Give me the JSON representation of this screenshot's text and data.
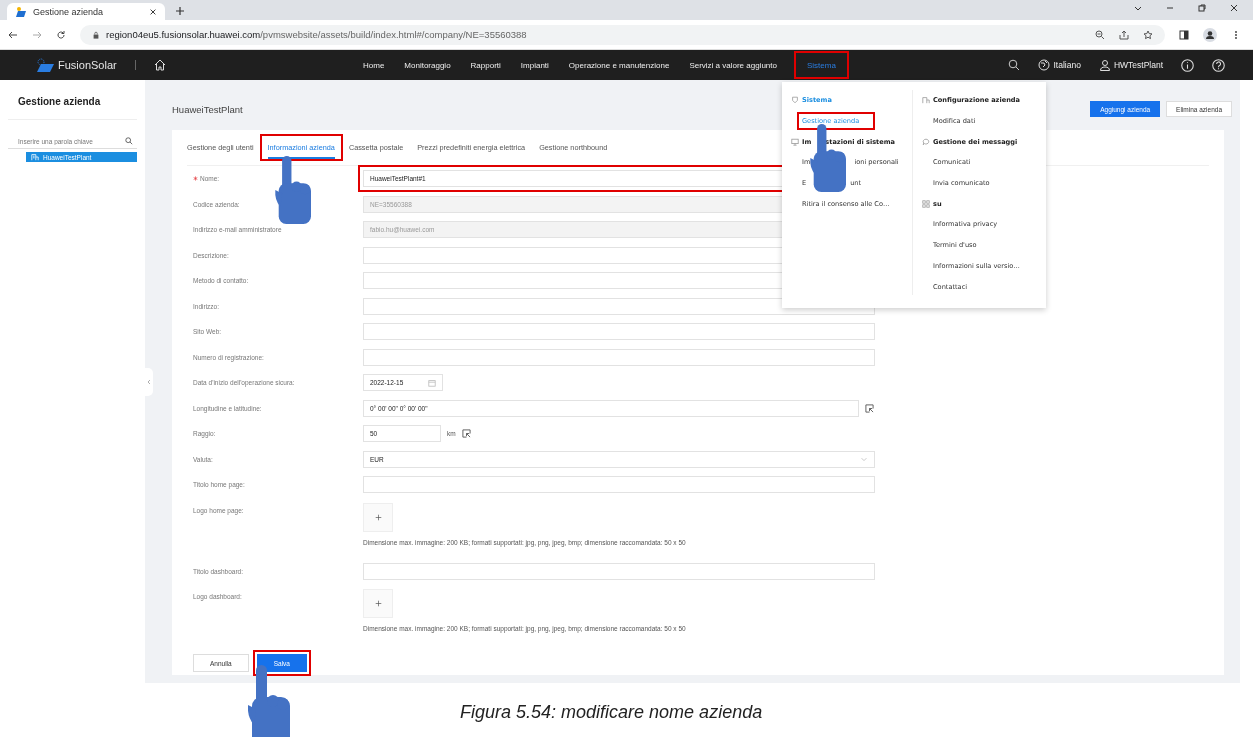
{
  "browser": {
    "tab": {
      "title": "Gestione azienda"
    },
    "url": {
      "host": "region04eu5.fusionsolar.huawei.com",
      "path": "/pvmswebsite/assets/build/index.html#/company/NE=35560388"
    }
  },
  "app_header": {
    "logo": "FusionSolar",
    "nav": [
      {
        "label": "Home",
        "selected": false,
        "highlighted": false
      },
      {
        "label": "Monitoraggio",
        "selected": false,
        "highlighted": false
      },
      {
        "label": "Rapporti",
        "selected": false,
        "highlighted": false
      },
      {
        "label": "Impianti",
        "selected": false,
        "highlighted": false
      },
      {
        "label": "Operazione e manutenzione",
        "selected": false,
        "highlighted": false
      },
      {
        "label": "Servizi a valore aggiunto",
        "selected": false,
        "highlighted": false
      },
      {
        "label": "Sistema",
        "selected": true,
        "highlighted": true
      }
    ],
    "language": "Italiano",
    "user": "HWTestPlant"
  },
  "sidebar": {
    "title": "Gestione azienda",
    "search": {
      "placeholder": "Inserire una parola chiave"
    },
    "tree": [
      {
        "label": "HuaweiTestPlant",
        "selected": true
      }
    ]
  },
  "page": {
    "title": "HuaweiTestPlant",
    "actions": [
      {
        "label": "Aggiungi azienda",
        "kind": "primary"
      },
      {
        "label": "Elimina azienda",
        "kind": "default"
      }
    ],
    "tabs": [
      {
        "label": "Gestione degli utenti",
        "selected": false,
        "highlighted": false
      },
      {
        "label": "Informazioni azienda",
        "selected": true,
        "highlighted": true
      },
      {
        "label": "Cassetta postale",
        "selected": false,
        "highlighted": false
      },
      {
        "label": "Prezzi predefiniti energia elettrica",
        "selected": false,
        "highlighted": false
      },
      {
        "label": "Gestione northbound",
        "selected": false,
        "highlighted": false
      }
    ],
    "form": [
      {
        "label": "Nome:",
        "kind": "text",
        "value": "HuaweiTestPlant#1",
        "required": true,
        "disabled": false,
        "highlighted": true
      },
      {
        "label": "Codice azienda:",
        "kind": "text",
        "value": "NE=35560388",
        "required": false,
        "disabled": true,
        "highlighted": false
      },
      {
        "label": "Indirizzo e-mail amministratore",
        "kind": "text",
        "value": "fabio.hu@huawei.com",
        "required": false,
        "disabled": true,
        "highlighted": false
      },
      {
        "label": "Descrizione:",
        "kind": "text",
        "required": false,
        "disabled": false,
        "highlighted": false
      },
      {
        "label": "Metodo di contatto:",
        "kind": "text",
        "required": false,
        "disabled": false,
        "highlighted": false
      },
      {
        "label": "Indirizzo:",
        "kind": "text",
        "required": false,
        "disabled": false,
        "highlighted": false
      },
      {
        "label": "Sito Web:",
        "kind": "text",
        "required": false,
        "disabled": false,
        "highlighted": false
      },
      {
        "label": "Numero di registrazione:",
        "kind": "text",
        "required": false,
        "disabled": false,
        "highlighted": false
      },
      {
        "label": "Data d'inizio dell'operazione sicura:",
        "kind": "date",
        "value": "2022-12-15",
        "required": false,
        "highlighted": false
      },
      {
        "label": "Longitudine e latitudine:",
        "kind": "coords",
        "value": "0° 00' 00\" 0° 00' 00\"",
        "required": false,
        "highlighted": false
      },
      {
        "label": "Raggio:",
        "kind": "number_unit",
        "value": "50",
        "unit": "km",
        "required": false,
        "highlighted": false
      },
      {
        "label": "Valuta:",
        "kind": "select",
        "value": "EUR",
        "required": false,
        "highlighted": false
      },
      {
        "label": "Titolo home page:",
        "kind": "text",
        "required": false,
        "disabled": false,
        "highlighted": false
      },
      {
        "label": "Logo home page:",
        "kind": "upload",
        "hint": "Dimensione max. immagine: 200 KB; formati supportati: jpg, png, jpeg, bmp; dimensione raccomandata: 50 x 50",
        "required": false,
        "highlighted": false
      },
      {
        "label": "Titolo dashboard:",
        "kind": "text",
        "required": false,
        "disabled": false,
        "highlighted": false
      },
      {
        "label": "Logo dashboard:",
        "kind": "upload",
        "hint": "Dimensione max. immagine: 200 KB; formati supportati: jpg, png, jpeg, bmp; dimensione raccomandata: 50 x 50",
        "required": false,
        "highlighted": false
      }
    ],
    "buttons": [
      {
        "label": "Annulla",
        "kind": "default",
        "highlighted": false
      },
      {
        "label": "Salva",
        "kind": "primary",
        "highlighted": true
      }
    ]
  },
  "system_menu": {
    "columns": [
      [
        {
          "kind": "header",
          "parts": [
            "Sistema"
          ],
          "selected": true,
          "highlighted": false
        },
        {
          "kind": "item",
          "parts": [
            "Gestione azienda"
          ],
          "selected": true,
          "highlighted": true
        },
        {
          "kind": "header",
          "parts": [
            "Im",
            "stazioni di sistema"
          ],
          "selected": false,
          "highlighted": false
        },
        {
          "kind": "item",
          "parts": [
            "Im",
            "ioni personali"
          ],
          "selected": false,
          "highlighted": false
        },
        {
          "kind": "item",
          "parts": [
            "E",
            "unt"
          ],
          "selected": false,
          "highlighted": false
        },
        {
          "kind": "item",
          "parts": [
            "Ritira il consenso alle Co…"
          ],
          "selected": false,
          "highlighted": false
        }
      ],
      [
        {
          "kind": "header",
          "parts": [
            "Configurazione azienda"
          ],
          "selected": false,
          "highlighted": false
        },
        {
          "kind": "item",
          "parts": [
            "Modifica dati"
          ],
          "selected": false,
          "highlighted": false
        },
        {
          "kind": "header",
          "parts": [
            "Gestione dei messaggi"
          ],
          "selected": false,
          "highlighted": false
        },
        {
          "kind": "item",
          "parts": [
            "Comunicati"
          ],
          "selected": false,
          "highlighted": false
        },
        {
          "kind": "item",
          "parts": [
            "Invia comunicato"
          ],
          "selected": false,
          "highlighted": false
        },
        {
          "kind": "header",
          "parts": [
            "su"
          ],
          "selected": false,
          "highlighted": false
        },
        {
          "kind": "item",
          "parts": [
            "Informativa privacy"
          ],
          "selected": false,
          "highlighted": false
        },
        {
          "kind": "item",
          "parts": [
            "Termini d'uso"
          ],
          "selected": false,
          "highlighted": false
        },
        {
          "kind": "item",
          "parts": [
            "Informazioni sulla versio…"
          ],
          "selected": false,
          "highlighted": false
        },
        {
          "kind": "item",
          "parts": [
            "Contattaci"
          ],
          "selected": false,
          "highlighted": false
        }
      ]
    ]
  },
  "caption": "Figura 5.54: modificare nome azienda"
}
